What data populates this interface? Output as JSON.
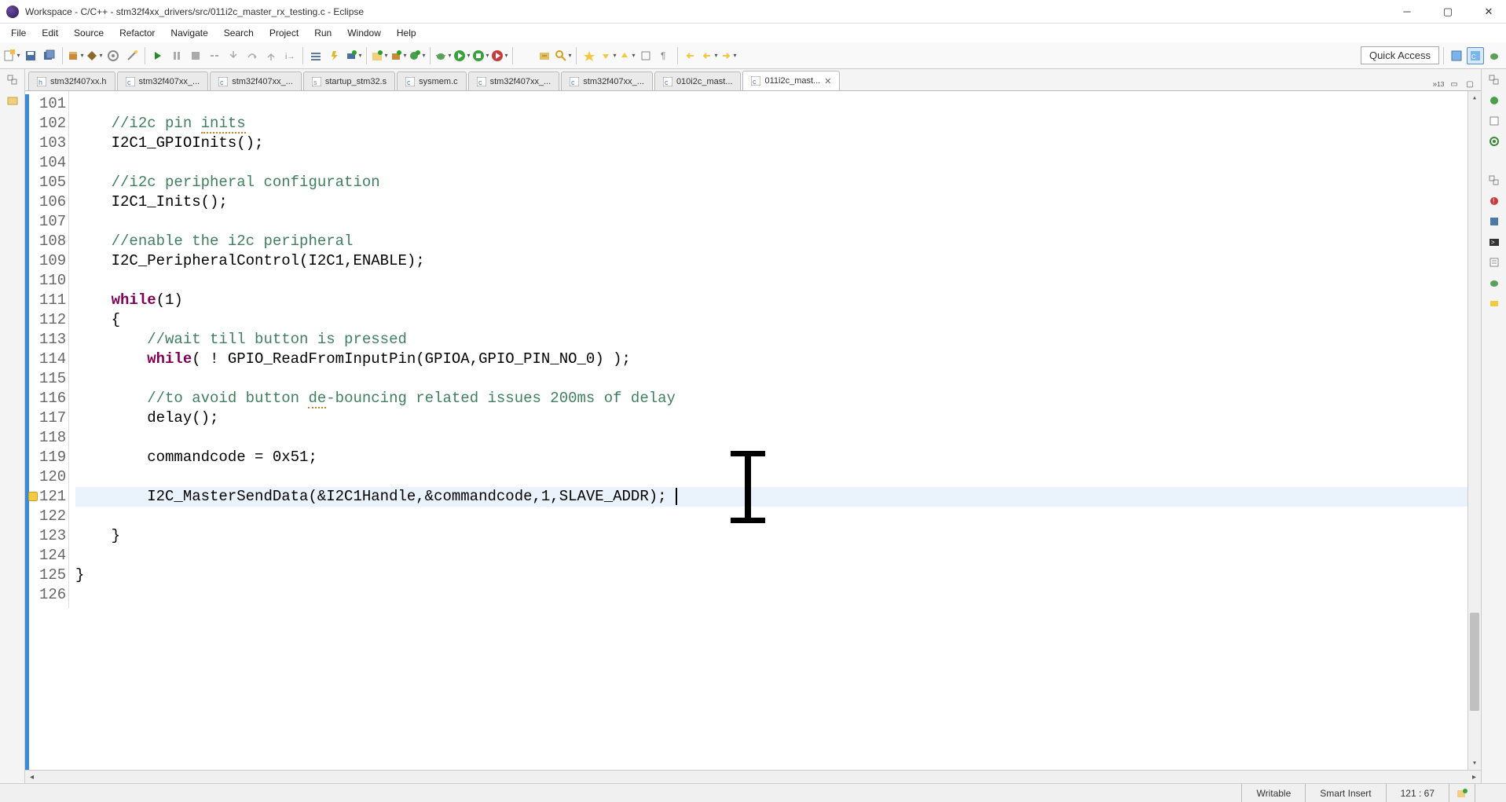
{
  "window": {
    "title": "Workspace - C/C++ - stm32f4xx_drivers/src/011i2c_master_rx_testing.c - Eclipse"
  },
  "menu": {
    "items": [
      "File",
      "Edit",
      "Source",
      "Refactor",
      "Navigate",
      "Search",
      "Project",
      "Run",
      "Window",
      "Help"
    ]
  },
  "toolbar": {
    "quick_access": "Quick Access"
  },
  "tabs": [
    {
      "label": "stm32f407xx.h",
      "active": false
    },
    {
      "label": "stm32f407xx_...",
      "active": false
    },
    {
      "label": "stm32f407xx_...",
      "active": false
    },
    {
      "label": "startup_stm32.s",
      "active": false
    },
    {
      "label": "sysmem.c",
      "active": false
    },
    {
      "label": "stm32f407xx_...",
      "active": false
    },
    {
      "label": "stm32f407xx_...",
      "active": false
    },
    {
      "label": "010i2c_mast...",
      "active": false
    },
    {
      "label": "011i2c_mast...",
      "active": true
    }
  ],
  "overflow_count": "13",
  "code": {
    "first_line": 101,
    "lines": [
      {
        "n": 101,
        "text": ""
      },
      {
        "n": 102,
        "text": "    //i2c pin inits",
        "comment": true,
        "wavy_word": "inits"
      },
      {
        "n": 103,
        "text": "    I2C1_GPIOInits();"
      },
      {
        "n": 104,
        "text": ""
      },
      {
        "n": 105,
        "text": "    //i2c peripheral configuration",
        "comment": true
      },
      {
        "n": 106,
        "text": "    I2C1_Inits();"
      },
      {
        "n": 107,
        "text": ""
      },
      {
        "n": 108,
        "text": "    //enable the i2c peripheral",
        "comment": true
      },
      {
        "n": 109,
        "text": "    I2C_PeripheralControl(I2C1,ENABLE);"
      },
      {
        "n": 110,
        "text": ""
      },
      {
        "n": 111,
        "text": "    while(1)",
        "keyword": "while"
      },
      {
        "n": 112,
        "text": "    {"
      },
      {
        "n": 113,
        "text": "        //wait till button is pressed",
        "comment": true
      },
      {
        "n": 114,
        "text": "        while( ! GPIO_ReadFromInputPin(GPIOA,GPIO_PIN_NO_0) );",
        "keyword": "while"
      },
      {
        "n": 115,
        "text": ""
      },
      {
        "n": 116,
        "text": "        //to avoid button de-bouncing related issues 200ms of delay",
        "comment": true,
        "wavy_word": "de"
      },
      {
        "n": 117,
        "text": "        delay();"
      },
      {
        "n": 118,
        "text": ""
      },
      {
        "n": 119,
        "text": "        commandcode = 0x51;"
      },
      {
        "n": 120,
        "text": ""
      },
      {
        "n": 121,
        "text": "        I2C_MasterSendData(&I2C1Handle,&commandcode,1,SLAVE_ADDR);",
        "highlight": true,
        "warn": true,
        "caret_after": true
      },
      {
        "n": 122,
        "text": ""
      },
      {
        "n": 123,
        "text": "    }"
      },
      {
        "n": 124,
        "text": ""
      },
      {
        "n": 125,
        "text": "}"
      },
      {
        "n": 126,
        "text": ""
      }
    ]
  },
  "status": {
    "writable": "Writable",
    "insert_mode": "Smart Insert",
    "position": "121 : 67"
  }
}
